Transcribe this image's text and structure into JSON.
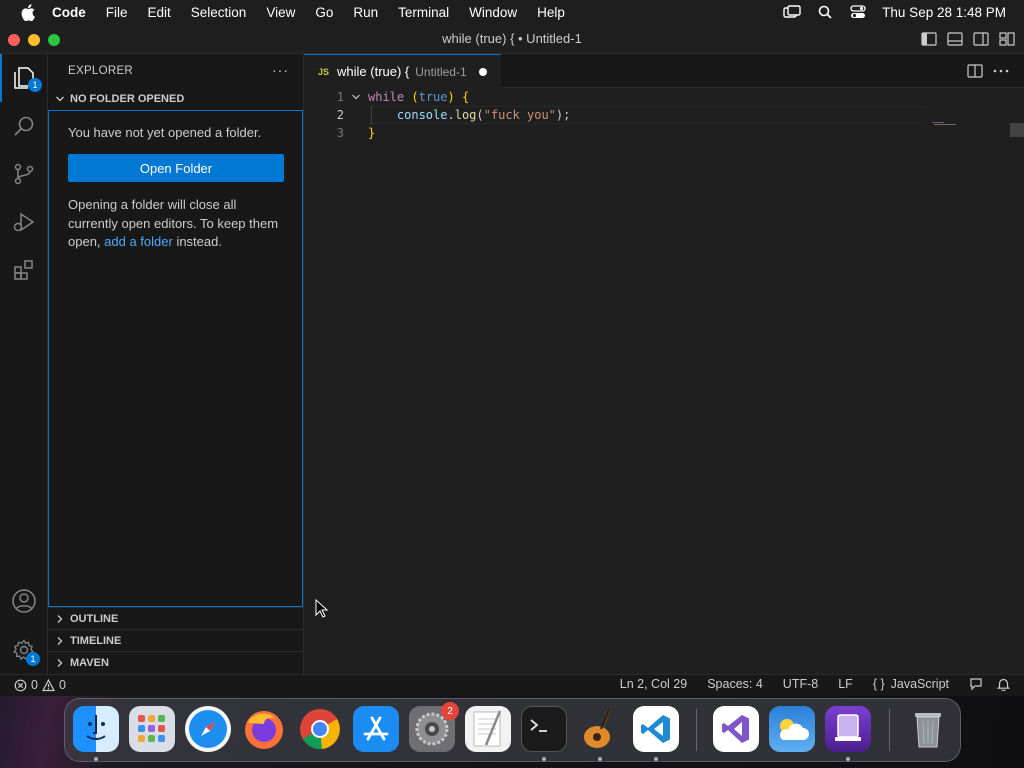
{
  "menubar": {
    "app_name": "Code",
    "items": [
      "File",
      "Edit",
      "Selection",
      "View",
      "Go",
      "Run",
      "Terminal",
      "Window",
      "Help"
    ],
    "clock": "Thu Sep 28  1:48 PM",
    "icons": [
      "apple-icon",
      "screen-mirroring-icon",
      "spotlight-search-icon",
      "control-center-icon"
    ]
  },
  "window": {
    "title": "while (true) { • Untitled-1"
  },
  "activity_bar": {
    "items": [
      "explorer-icon",
      "search-icon",
      "source-control-icon",
      "run-debug-icon",
      "extensions-icon"
    ],
    "explorer_badge": "1",
    "bottom": [
      "accounts-icon",
      "manage-gear-icon"
    ],
    "manage_badge": "1"
  },
  "sidebar": {
    "title": "EXPLORER",
    "more": "···",
    "section_title": "NO FOLDER OPENED",
    "message": "You have not yet opened a folder.",
    "open_button": "Open Folder",
    "note_before": "Opening a folder will close all currently open editors. To keep them open, ",
    "note_link": "add a folder",
    "note_after": " instead.",
    "lower_sections": [
      "OUTLINE",
      "TIMELINE",
      "MAVEN"
    ]
  },
  "editor": {
    "tab": {
      "lang_badge": "JS",
      "name": "while (true) {",
      "description": "Untitled-1",
      "modified": true
    },
    "lines": [
      {
        "number": "1",
        "tokens": [
          [
            "kw",
            "while"
          ],
          [
            "def",
            " "
          ],
          [
            "punc",
            "("
          ],
          [
            "bool",
            "true"
          ],
          [
            "punc",
            ")"
          ],
          [
            "def",
            " "
          ],
          [
            "punc",
            "{"
          ]
        ]
      },
      {
        "number": "2",
        "tokens": [
          [
            "def",
            "    "
          ],
          [
            "var",
            "console"
          ],
          [
            "def",
            "."
          ],
          [
            "fn",
            "log"
          ],
          [
            "def",
            "("
          ],
          [
            "str",
            "\"fuck you\""
          ],
          [
            "def",
            ");"
          ]
        ]
      },
      {
        "number": "3",
        "tokens": [
          [
            "punc",
            "}"
          ]
        ]
      }
    ],
    "current_line": 2
  },
  "statusbar": {
    "errors": "0",
    "warnings": "0",
    "position": "Ln 2, Col 29",
    "spaces": "Spaces: 4",
    "encoding": "UTF-8",
    "eol": "LF",
    "language_icon": "{ }",
    "language": "JavaScript"
  },
  "dock": {
    "apps": [
      "Finder",
      "Launchpad",
      "Safari",
      "Firefox",
      "Google Chrome",
      "App Store",
      "System Settings",
      "TextEdit",
      "Terminal",
      "GarageBand",
      "Visual Studio Code",
      "Visual Studio",
      "Weather",
      "Simulator",
      "Trash"
    ],
    "settings_badge": "2"
  },
  "colors": {
    "accent": "#0078d4",
    "link": "#4daafc",
    "keyword": "#c586c0",
    "boolean": "#569cd6",
    "string": "#ce9178"
  }
}
